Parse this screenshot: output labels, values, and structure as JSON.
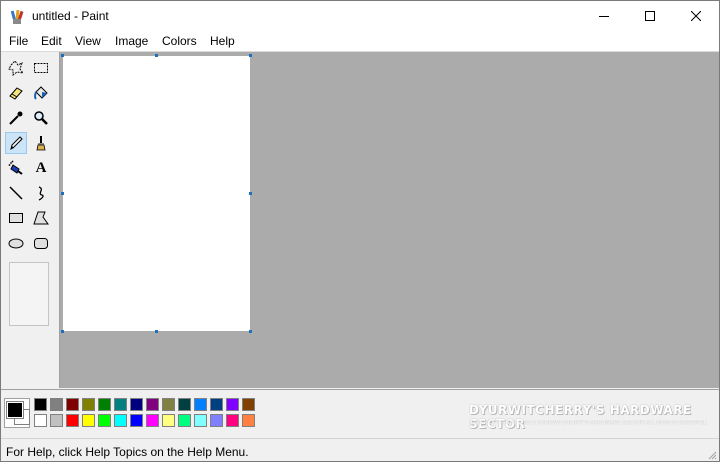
{
  "window": {
    "title": "untitled - Paint",
    "controls": {
      "minimize": "minimize-button",
      "maximize": "maximize-button",
      "close": "close-button"
    }
  },
  "menu": {
    "file": "File",
    "edit": "Edit",
    "view": "View",
    "image": "Image",
    "colors": "Colors",
    "help": "Help"
  },
  "tools": [
    {
      "icon": "free-form-select-icon"
    },
    {
      "icon": "rectangle-select-icon"
    },
    {
      "icon": "eraser-icon"
    },
    {
      "icon": "fill-bucket-icon"
    },
    {
      "icon": "color-picker-icon"
    },
    {
      "icon": "magnifier-icon"
    },
    {
      "icon": "pencil-icon",
      "selected": true
    },
    {
      "icon": "brush-icon"
    },
    {
      "icon": "airbrush-icon"
    },
    {
      "icon": "text-icon",
      "label": "A"
    },
    {
      "icon": "line-icon"
    },
    {
      "icon": "curve-icon"
    },
    {
      "icon": "rectangle-icon"
    },
    {
      "icon": "polygon-icon"
    },
    {
      "icon": "ellipse-icon"
    },
    {
      "icon": "rounded-rectangle-icon"
    }
  ],
  "palette": {
    "foreground": "#000000",
    "background": "#ffffff",
    "top_row": [
      "#000000",
      "#808080",
      "#800000",
      "#808000",
      "#008000",
      "#008080",
      "#000080",
      "#800080",
      "#808040",
      "#004040",
      "#0080ff",
      "#004080",
      "#8000ff",
      "#804000"
    ],
    "bottom_row": [
      "#ffffff",
      "#c0c0c0",
      "#ff0000",
      "#ffff00",
      "#00ff00",
      "#00ffff",
      "#0000ff",
      "#ff00ff",
      "#ffff80",
      "#00ff80",
      "#80ffff",
      "#8080ff",
      "#ff0080",
      "#ff8040"
    ]
  },
  "watermark": {
    "title": "DYURWITCHERRY'S HARDWARE SECTOR",
    "subtitle": "BLOG COPYRIGHT © 2013 DYURWITCHERRY'S HARDWARE SECTOR ALL RIGHTS RESERVED."
  },
  "status": {
    "help_text": "For Help, click Help Topics on the Help Menu."
  }
}
